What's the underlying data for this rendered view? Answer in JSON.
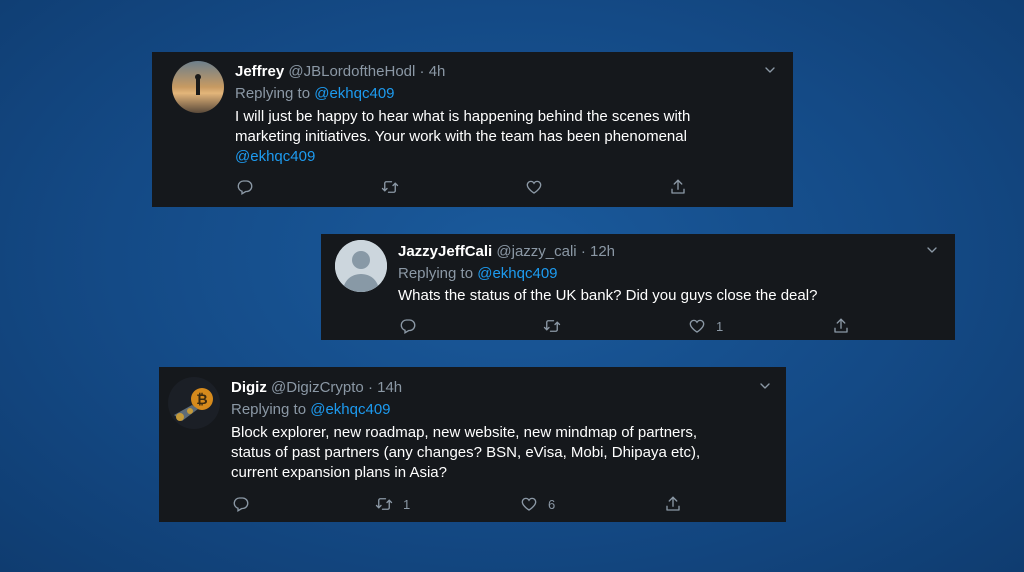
{
  "tweets": [
    {
      "name": "Jeffrey",
      "handle": "@JBLordoftheHodl",
      "time": "4h",
      "replying_label": "Replying to",
      "replying_to": "@ekhqc409",
      "body_lines": [
        "I will just be happy to hear what is happening behind the scenes with",
        "marketing initiatives. Your work with the team has been phenomenal"
      ],
      "body_mention": "@ekhqc409",
      "retweets": "",
      "likes": ""
    },
    {
      "name": "JazzyJeffCali",
      "handle": "@jazzy_cali",
      "time": "12h",
      "replying_label": "Replying to",
      "replying_to": "@ekhqc409",
      "body_lines": [
        "Whats the status of the UK bank? Did you guys close the deal?"
      ],
      "retweets": "",
      "likes": "1"
    },
    {
      "name": "Digiz",
      "handle": "@DigizCrypto",
      "time": "14h",
      "replying_label": "Replying to",
      "replying_to": "@ekhqc409",
      "body_lines": [
        "Block explorer, new roadmap, new website, new mindmap of partners,",
        "status of past partners (any changes? BSN, eVisa, Mobi, Dhipaya etc),",
        "current expansion plans in Asia?"
      ],
      "retweets": "1",
      "likes": "6"
    }
  ],
  "icons": [
    "reply-icon",
    "retweet-icon",
    "like-icon",
    "share-icon",
    "chevron-down-icon"
  ],
  "colors": {
    "background": "#144a86",
    "card": "#15181c",
    "link": "#1d9bf0",
    "muted": "#8b98a5"
  }
}
